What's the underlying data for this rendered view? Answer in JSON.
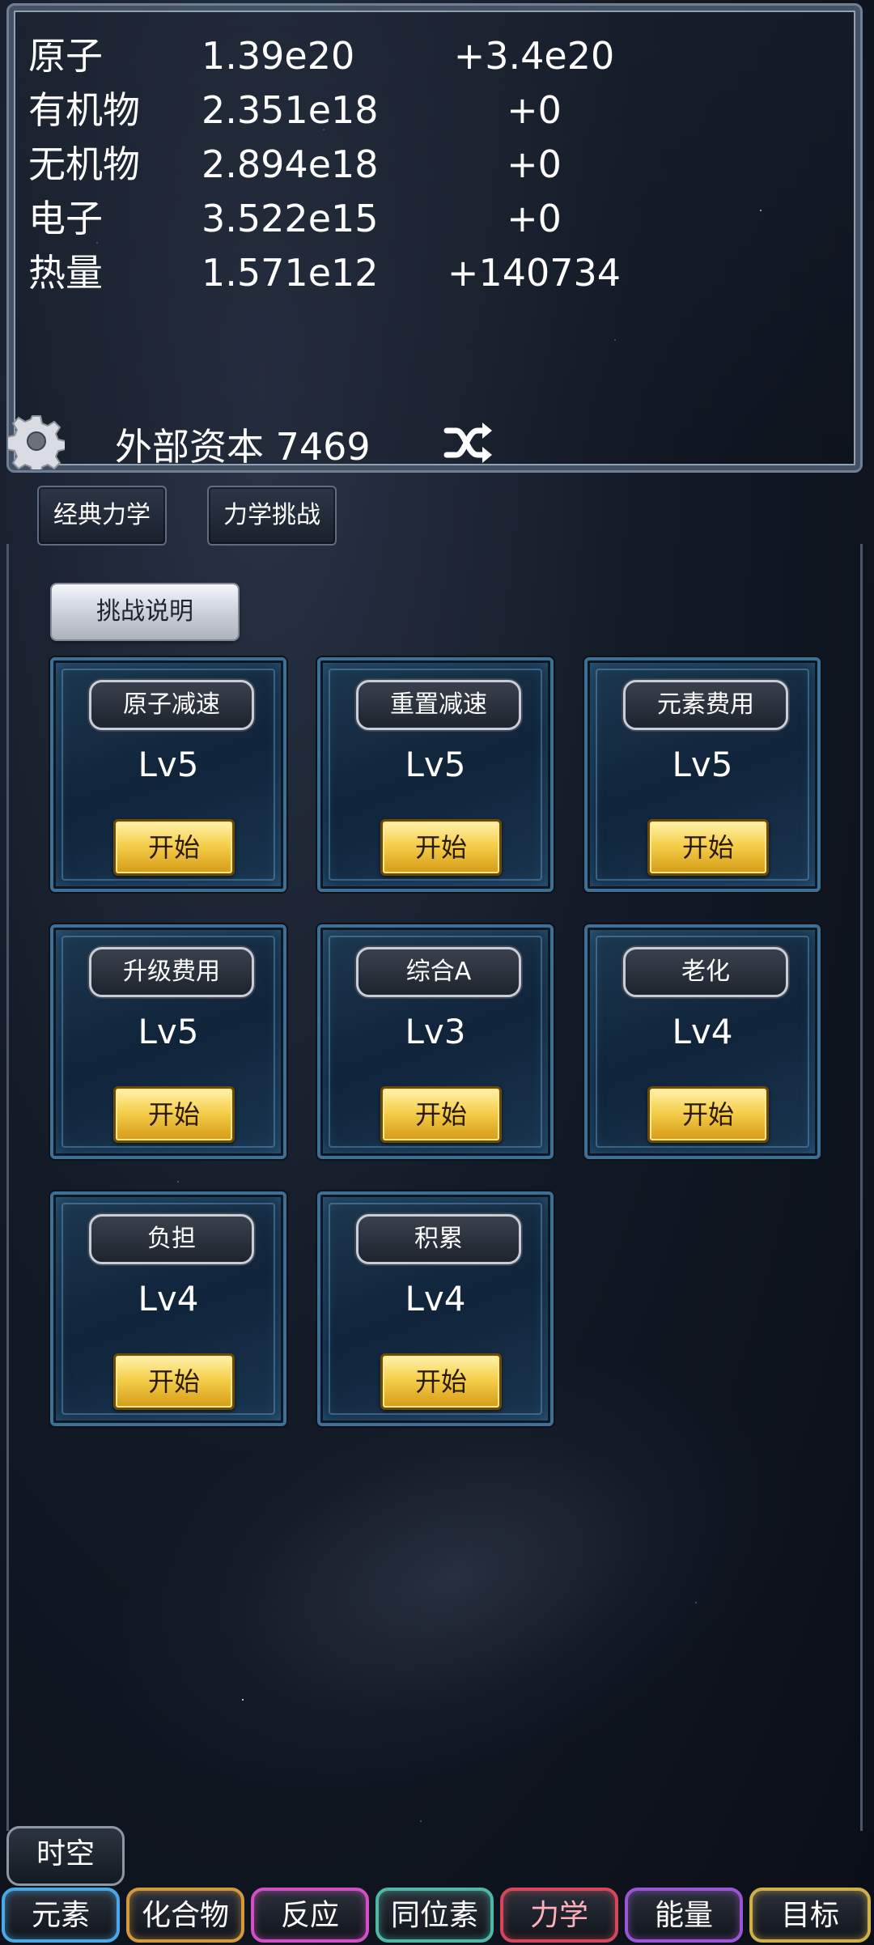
{
  "resources": [
    {
      "name": "原子",
      "value": "1.39e20",
      "rate": "+3.4e20"
    },
    {
      "name": "有机物",
      "value": "2.351e18",
      "rate": "+0"
    },
    {
      "name": "无机物",
      "value": "2.894e18",
      "rate": "+0"
    },
    {
      "name": "电子",
      "value": "3.522e15",
      "rate": "+0"
    },
    {
      "name": "热量",
      "value": "1.571e12",
      "rate": "+140734"
    }
  ],
  "capital": {
    "text": "外部资本 7469"
  },
  "icons": {
    "settings": "gear-icon",
    "switch": "shuffle-icon"
  },
  "tabs": {
    "classic": "经典力学",
    "challenge": "力学挑战",
    "active": "力学挑战"
  },
  "help_button": "挑战说明",
  "challenges": [
    {
      "name": "原子减速",
      "level": "Lv5",
      "start": "开始"
    },
    {
      "name": "重置减速",
      "level": "Lv5",
      "start": "开始"
    },
    {
      "name": "元素费用",
      "level": "Lv5",
      "start": "开始"
    },
    {
      "name": "升级费用",
      "level": "Lv5",
      "start": "开始"
    },
    {
      "name": "综合A",
      "level": "Lv3",
      "start": "开始"
    },
    {
      "name": "老化",
      "level": "Lv4",
      "start": "开始"
    },
    {
      "name": "负担",
      "level": "Lv4",
      "start": "开始"
    },
    {
      "name": "积累",
      "level": "Lv4",
      "start": "开始"
    }
  ],
  "spacetime": "时空",
  "bottom_nav": {
    "elements": "元素",
    "compounds": "化合物",
    "reactions": "反应",
    "isotopes": "同位素",
    "mechanics": "力学",
    "energy": "能量",
    "goals": "目标",
    "active": "力学"
  },
  "colors": {
    "element_tab": "#4aa8e8",
    "compound_tab": "#d39a3c",
    "reaction_tab": "#d24fc6",
    "isotope_tab": "#4fb7a8",
    "mechanics_tab": "#d6475b",
    "energy_tab": "#9a55d6",
    "goal_tab": "#cfb04a",
    "start_button": "#f5cf4b"
  }
}
